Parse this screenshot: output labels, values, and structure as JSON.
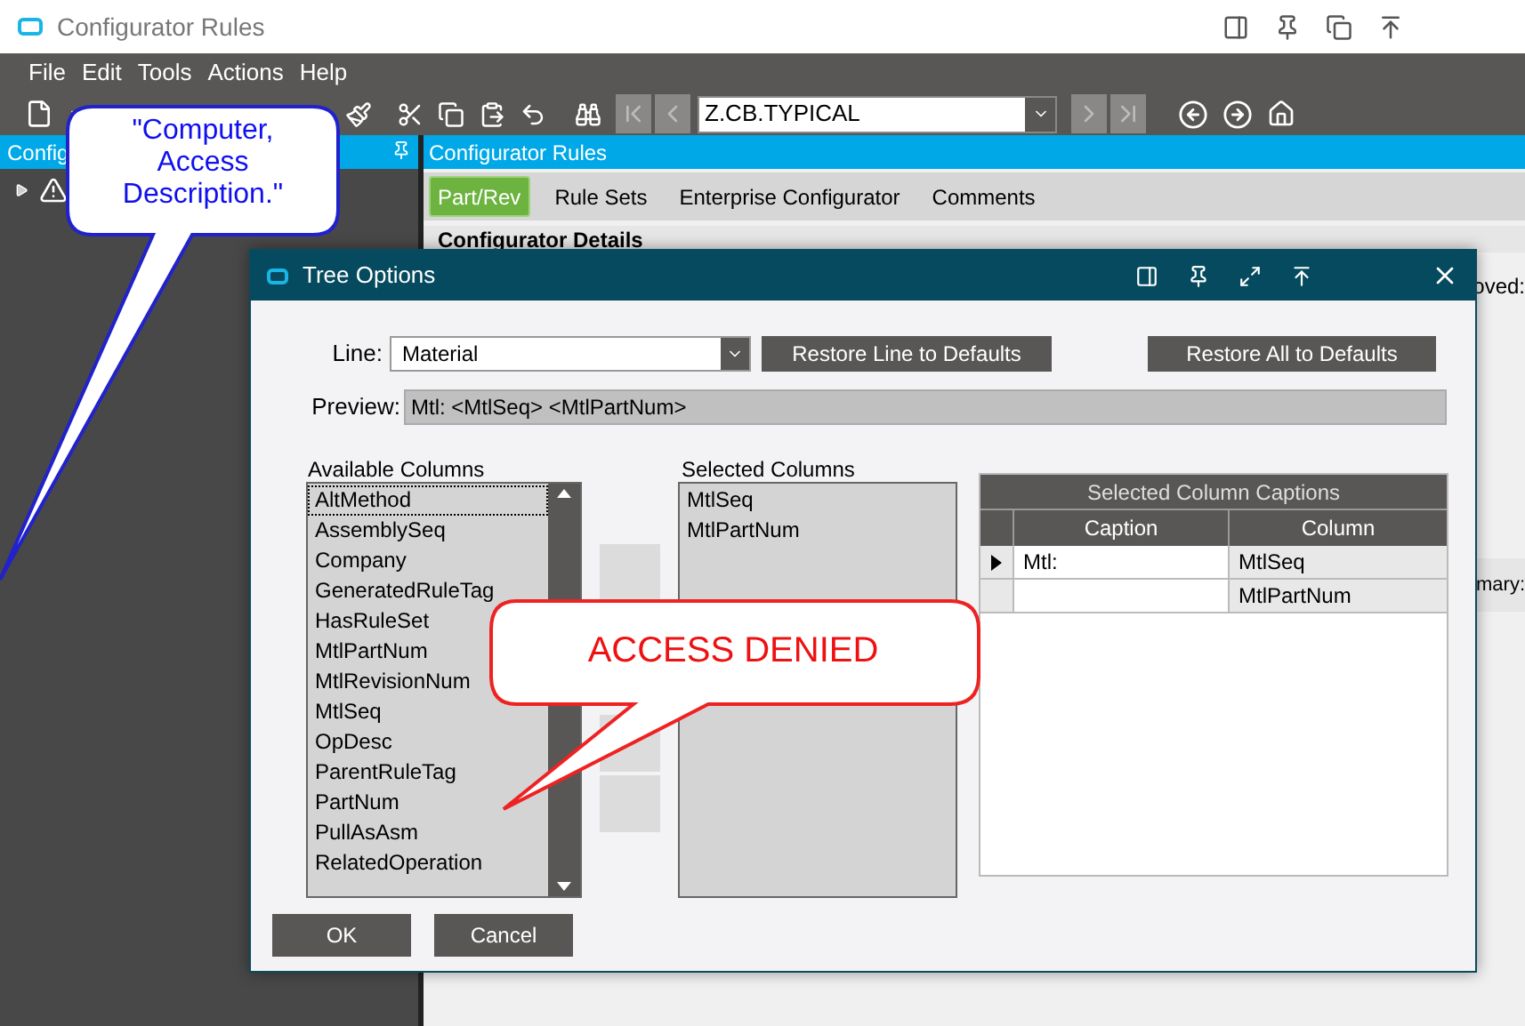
{
  "window": {
    "title": "Configurator Rules"
  },
  "menu": [
    "File",
    "Edit",
    "Tools",
    "Actions",
    "Help"
  ],
  "toolbar": {
    "record_field": {
      "value": "Z.CB.TYPICAL"
    }
  },
  "left_panel": {
    "title": "Config"
  },
  "main_panel": {
    "title": "Configurator Rules",
    "tabs": [
      {
        "label": "Part/Rev",
        "selected": true
      },
      {
        "label": "Rule Sets",
        "selected": false
      },
      {
        "label": "Enterprise Configurator",
        "selected": false
      },
      {
        "label": "Comments",
        "selected": false
      }
    ],
    "section_title": "Configurator Details",
    "fragments": [
      "oved:",
      "mary:"
    ]
  },
  "dialog": {
    "title": "Tree Options",
    "line": {
      "label": "Line:",
      "value": "Material"
    },
    "buttons": [
      "Restore Line to Defaults",
      "Restore All to Defaults"
    ],
    "preview": {
      "label": "Preview:",
      "value": "Mtl: <MtlSeq> <MtlPartNum>"
    },
    "available_columns": {
      "title": "Available Columns",
      "items": [
        {
          "label": "AltMethod",
          "selected": true
        },
        {
          "label": "AssemblySeq",
          "selected": false
        },
        {
          "label": "Company",
          "selected": false
        },
        {
          "label": "GeneratedRuleTag",
          "selected": false
        },
        {
          "label": "HasRuleSet",
          "selected": false
        },
        {
          "label": "MtlPartNum",
          "selected": false
        },
        {
          "label": "MtlRevisionNum",
          "selected": false
        },
        {
          "label": "MtlSeq",
          "selected": false
        },
        {
          "label": "OpDesc",
          "selected": false
        },
        {
          "label": "ParentRuleTag",
          "selected": false
        },
        {
          "label": "PartNum",
          "selected": false
        },
        {
          "label": "PullAsAsm",
          "selected": false
        },
        {
          "label": "RelatedOperation",
          "selected": false
        }
      ]
    },
    "selected_columns": {
      "title": "Selected Columns",
      "items": [
        "MtlSeq",
        "MtlPartNum"
      ]
    },
    "captions": {
      "title": "Selected Column Captions",
      "columns": [
        "Caption",
        "Column"
      ],
      "rows": [
        {
          "caption": "Mtl:",
          "column": "MtlSeq",
          "selected": true
        },
        {
          "column": "MtlPartNum",
          "selected": false
        }
      ]
    },
    "footer_buttons": [
      "OK",
      "Cancel"
    ]
  },
  "callouts": [
    {
      "kind": "note",
      "text": "\"Computer, Access Description.\""
    },
    {
      "kind": "alert",
      "text": "ACCESS DENIED"
    }
  ]
}
